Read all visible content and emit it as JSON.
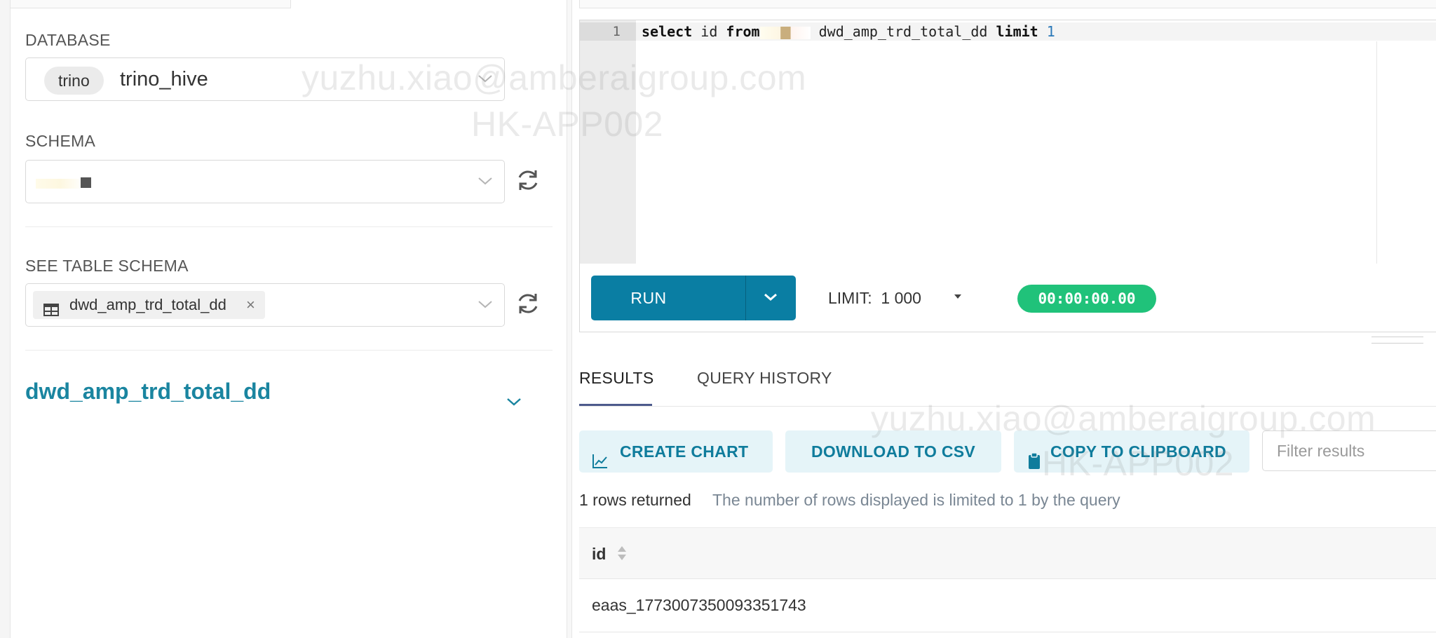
{
  "left_panel": {
    "database": {
      "label": "DATABASE",
      "engine_pill": "trino",
      "selected": "trino_hive"
    },
    "schema": {
      "label": "SCHEMA"
    },
    "table_schema": {
      "label": "SEE TABLE SCHEMA",
      "selected_tag": "dwd_amp_trd_total_dd",
      "remove_glyph": "×"
    },
    "expanded_table": {
      "name": "dwd_amp_trd_total_dd"
    }
  },
  "editor": {
    "line_number": "1",
    "code_kw_select": "select",
    "code_col": " id ",
    "code_kw_from": "from",
    "code_table": " dwd_amp_trd_total_dd ",
    "code_kw_limit": "limit",
    "code_limit_value": "1"
  },
  "toolbar": {
    "run_label": "RUN",
    "limit_label": "LIMIT:",
    "limit_value": "1 000",
    "timer": "00:00:00.00"
  },
  "tabs": {
    "results": "RESULTS",
    "history": "QUERY HISTORY"
  },
  "actions": {
    "create_chart": "CREATE CHART",
    "download_csv": "DOWNLOAD TO CSV",
    "copy_clipboard": "COPY TO CLIPBOARD",
    "filter_placeholder": "Filter results"
  },
  "results": {
    "rows_returned": "1 rows returned",
    "limit_note": "The number of rows displayed is limited to 1 by the query",
    "columns": [
      "id"
    ],
    "rows": [
      [
        "eaas_1773007350093351743"
      ]
    ]
  },
  "watermark": {
    "email": "yuzhu.xiao@amberaigroup.com",
    "host": "HK-APP002"
  },
  "colors": {
    "accent": "#0a7ea3",
    "timer_green": "#20c27a",
    "title_teal": "#1a85a0",
    "action_bg": "#e5f4f8"
  },
  "icons": {
    "refresh": "refresh-icon",
    "chevron": "chevron-down-icon",
    "table": "table-icon",
    "chart": "line-chart-icon",
    "clipboard": "clipboard-icon",
    "sort": "sort-icon"
  }
}
